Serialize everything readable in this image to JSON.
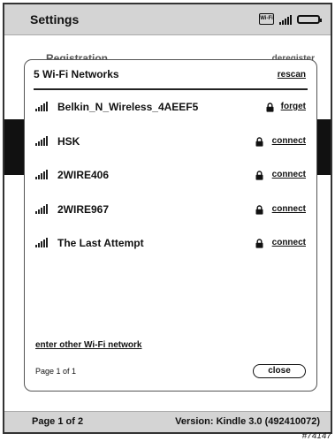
{
  "topbar": {
    "title": "Settings"
  },
  "status_icons": [
    "wifi-icon",
    "signal-icon",
    "battery-icon"
  ],
  "background": {
    "row_label": "Registration",
    "row_action": "deregister"
  },
  "dialog": {
    "title": "5 Wi-Fi Networks",
    "rescan_label": "rescan",
    "networks": [
      {
        "name": "Belkin_N_Wireless_4AEEF5",
        "action": "forget",
        "locked": true
      },
      {
        "name": "HSK",
        "action": "connect",
        "locked": true
      },
      {
        "name": "2WIRE406",
        "action": "connect",
        "locked": true
      },
      {
        "name": "2WIRE967",
        "action": "connect",
        "locked": true
      },
      {
        "name": "The Last Attempt",
        "action": "connect",
        "locked": true
      }
    ],
    "other_network_label": "enter other Wi-Fi network",
    "page_info": "Page 1 of 1",
    "close_label": "close"
  },
  "bottombar": {
    "page": "Page 1 of 2",
    "version": "Version: Kindle 3.0 (492410072)"
  },
  "watermark": "#74147"
}
